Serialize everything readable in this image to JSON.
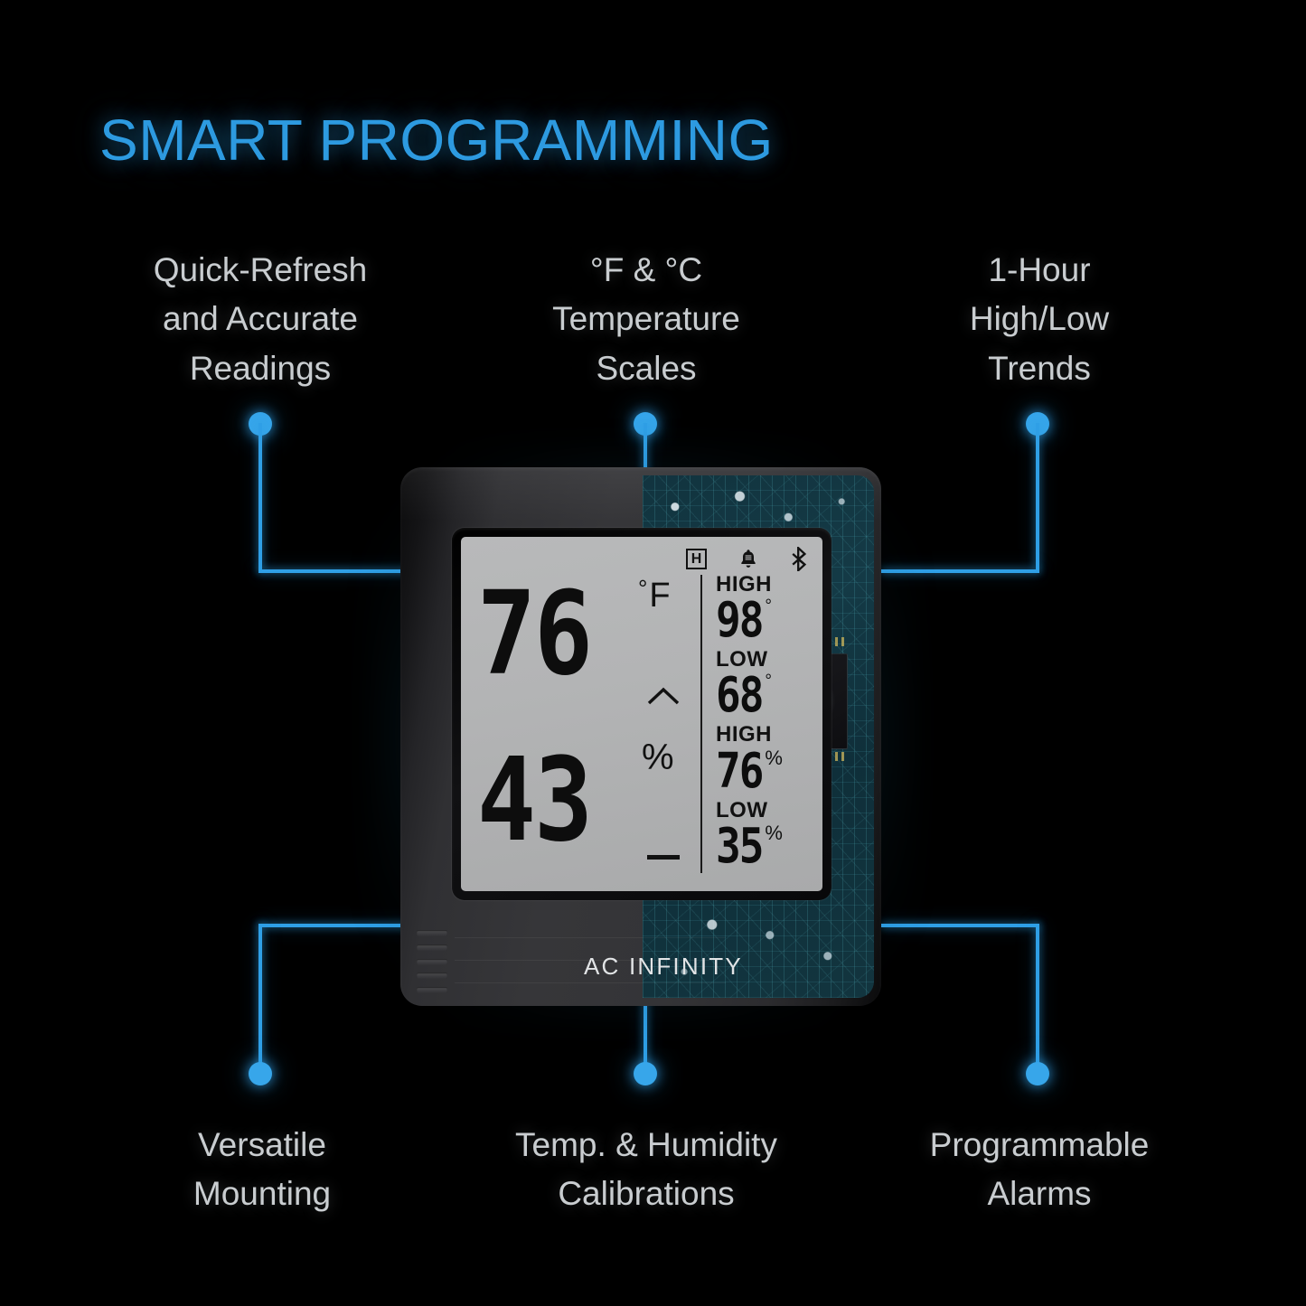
{
  "title": "SMART PROGRAMMING",
  "theme": {
    "background": "#000000",
    "accent_blue": "#2f9fe6",
    "title_blue": "#2d9ae0",
    "label_gray": "#c9cdd0",
    "lcd_background": "#b3b4b5",
    "lcd_ink": "#0d0d0d"
  },
  "features": {
    "top": [
      {
        "name": "quick-refresh",
        "lines": [
          "Quick-Refresh",
          "and Accurate",
          "Readings"
        ]
      },
      {
        "name": "temperature-scales",
        "lines": [
          "°F & °C",
          "Temperature",
          "Scales"
        ]
      },
      {
        "name": "high-low-trends",
        "lines": [
          "1-Hour",
          "High/Low",
          "Trends"
        ]
      }
    ],
    "bottom": [
      {
        "name": "versatile-mounting",
        "lines": [
          "Versatile",
          "Mounting"
        ]
      },
      {
        "name": "temp-humidity-calibrations",
        "lines": [
          "Temp. & Humidity",
          "Calibrations"
        ]
      },
      {
        "name": "programmable-alarms",
        "lines": [
          "Programmable",
          "Alarms"
        ]
      }
    ]
  },
  "device": {
    "brand": "AC INFINITY",
    "display": {
      "status_icons": [
        {
          "name": "hold-indicator",
          "glyph": "H"
        },
        {
          "name": "alarm-bell",
          "glyph": "bell"
        },
        {
          "name": "bluetooth",
          "glyph": "bluetooth"
        }
      ],
      "temperature": {
        "value": "76",
        "degree": "°",
        "unit": "F",
        "trend": "up"
      },
      "humidity": {
        "value": "43",
        "unit": "%",
        "trend": "steady"
      },
      "high_low": [
        {
          "label": "HIGH",
          "value": "98",
          "unit": "°",
          "metric": "temperature"
        },
        {
          "label": "LOW",
          "value": "68",
          "unit": "°",
          "metric": "temperature"
        },
        {
          "label": "HIGH",
          "value": "76",
          "unit": "%",
          "metric": "humidity"
        },
        {
          "label": "LOW",
          "value": "35",
          "unit": "%",
          "metric": "humidity"
        }
      ]
    }
  }
}
